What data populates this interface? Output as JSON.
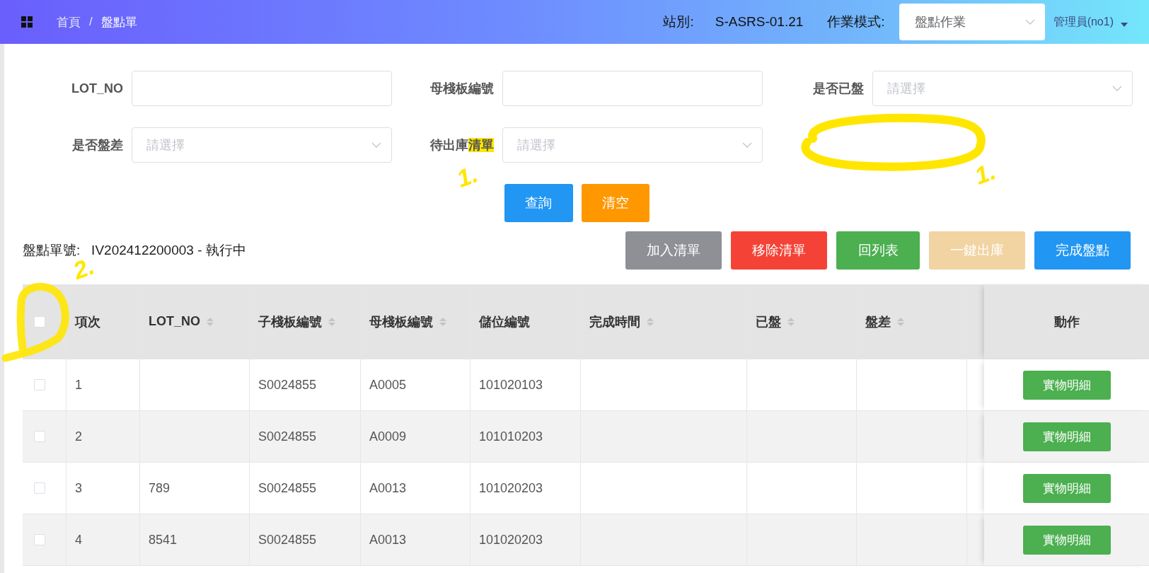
{
  "header": {
    "breadcrumb": [
      "首頁",
      "盤點單"
    ],
    "separator": "/",
    "station_label": "站別:",
    "station": "S-ASRS-01.21",
    "mode_label": "作業模式:",
    "mode": "盤點作業",
    "user": "管理員(no1)"
  },
  "filters": [
    {
      "label_parts": [
        {
          "text": "LOT_NO",
          "highlighted": false
        }
      ],
      "kind": "input"
    },
    {
      "label_parts": [
        {
          "text": "母棧板編號",
          "highlighted": false
        }
      ],
      "kind": "input"
    },
    {
      "label_parts": [
        {
          "text": "是否已盤",
          "highlighted": false
        }
      ],
      "kind": "select",
      "placeholder": "請選擇"
    },
    {
      "label_parts": [
        {
          "text": "是否盤差",
          "highlighted": false
        }
      ],
      "kind": "select",
      "placeholder": "請選擇"
    },
    {
      "label_parts": [
        {
          "text": "待出庫",
          "highlighted": false
        },
        {
          "text": "清單",
          "highlighted": true
        }
      ],
      "kind": "select",
      "placeholder": "請選擇"
    }
  ],
  "search_buttons": [
    {
      "label": "查詢",
      "kind": "primary"
    },
    {
      "label": "清空",
      "kind": "warning"
    }
  ],
  "order": {
    "label": "盤點單號:",
    "value": "IV202412200003 - 執行中"
  },
  "actions": [
    {
      "label": "加入清單",
      "kind": "gray",
      "disabled": false
    },
    {
      "label": "移除清單",
      "kind": "danger",
      "disabled": false
    },
    {
      "label": "回列表",
      "kind": "success",
      "disabled": false
    },
    {
      "label": "一鍵出庫",
      "kind": "warning",
      "disabled": true
    },
    {
      "label": "完成盤點",
      "kind": "primary",
      "disabled": false
    }
  ],
  "table": {
    "select_all": {
      "checked": false
    },
    "columns": [
      {
        "label": "項次",
        "sortable": false
      },
      {
        "label": "LOT_NO",
        "sortable": true
      },
      {
        "label": "子棧板編號",
        "sortable": true
      },
      {
        "label": "母棧板編號",
        "sortable": true
      },
      {
        "label": "儲位編號",
        "sortable": false
      },
      {
        "label": "完成時間",
        "sortable": true
      },
      {
        "label": "已盤",
        "sortable": true
      },
      {
        "label": "盤差",
        "sortable": true
      }
    ],
    "action_column": "動作",
    "rows": [
      {
        "checked": false,
        "cells": [
          "1",
          null,
          "S0024855",
          "A0005",
          "101020103",
          null,
          null,
          null
        ],
        "action": "實物明細"
      },
      {
        "checked": false,
        "cells": [
          "2",
          null,
          "S0024855",
          "A0009",
          "101010203",
          null,
          null,
          null
        ],
        "action": "實物明細"
      },
      {
        "checked": false,
        "cells": [
          "3",
          "789",
          "S0024855",
          "A0013",
          "101020203",
          null,
          null,
          null
        ],
        "action": "實物明細"
      },
      {
        "checked": false,
        "cells": [
          "4",
          "8541",
          "S0024855",
          "A0013",
          "101020203",
          null,
          null,
          null
        ],
        "action": "實物明細"
      }
    ]
  },
  "annotations": [
    {
      "kind": "mark",
      "text": "1."
    },
    {
      "kind": "mark",
      "text": "1."
    },
    {
      "kind": "mark",
      "text": "2."
    },
    {
      "kind": "ellipse"
    },
    {
      "kind": "circle"
    }
  ]
}
